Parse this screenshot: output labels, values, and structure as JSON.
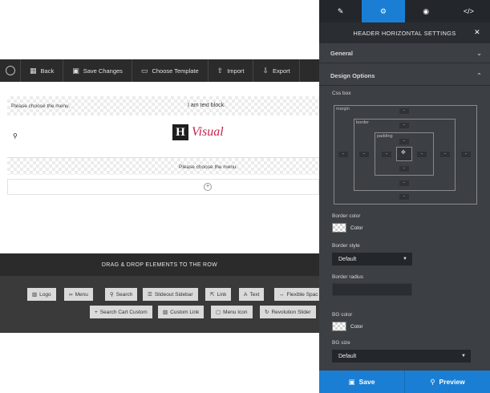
{
  "toolbar": {
    "logo_icon": "wordpress-icon",
    "back": "Back",
    "save": "Save Changes",
    "template": "Choose Template",
    "import": "Import",
    "export": "Export"
  },
  "canvas": {
    "menu_placeholder_1": "Please choose the menu.",
    "text_block": "I am text block.",
    "logo_letter": "H",
    "logo_text": "Visual",
    "menu_placeholder_2": "Please choose the menu.",
    "add_icon": "+"
  },
  "drag_panel": {
    "title": "DRAG & DROP ELEMENTS TO THE ROW",
    "elements": [
      {
        "label": "Logo",
        "icon": "image-icon"
      },
      {
        "label": "Menu",
        "icon": "link-icon"
      },
      {
        "label": "Search",
        "icon": "search-icon"
      },
      {
        "label": "Slideout Sidebar",
        "icon": "sidebar-icon"
      },
      {
        "label": "Link",
        "icon": "share-icon"
      },
      {
        "label": "Text",
        "icon": "text-icon"
      },
      {
        "label": "Flexible Spac",
        "icon": "arrows-icon"
      },
      {
        "label": "Search Cart Custom",
        "icon": "plus-icon"
      },
      {
        "label": "Custom Link",
        "icon": "image-icon"
      },
      {
        "label": "Menu Icon",
        "icon": "comment-icon"
      },
      {
        "label": "Revolution Slider",
        "icon": "refresh-icon"
      }
    ]
  },
  "panel": {
    "tabs": [
      {
        "name": "pencil",
        "glyph": "✎"
      },
      {
        "name": "gear",
        "glyph": "⚙"
      },
      {
        "name": "eye",
        "glyph": "◉"
      },
      {
        "name": "code",
        "glyph": "</>"
      }
    ],
    "title": "HEADER HORIZONTAL SETTINGS",
    "close": "✕",
    "section_general": "General",
    "section_design": "Design Options",
    "css_box_label": "Css box",
    "box_margin": "margin",
    "box_border": "border",
    "box_padding": "padding",
    "box_value": "-",
    "border_color_label": "Border color",
    "border_color_value": "Color",
    "border_style_label": "Border style",
    "border_style_value": "Default",
    "border_radius_label": "Border radius",
    "bg_color_label": "BG color",
    "bg_color_value": "Color",
    "bg_size_label": "BG size",
    "bg_size_value": "Default",
    "save": "Save",
    "preview": "Preview"
  },
  "colors": {
    "accent": "#1a7fd4",
    "toolbar_bg": "#2b2b2b",
    "panel_bg": "#3c3f44",
    "logo_red": "#c7254e"
  }
}
